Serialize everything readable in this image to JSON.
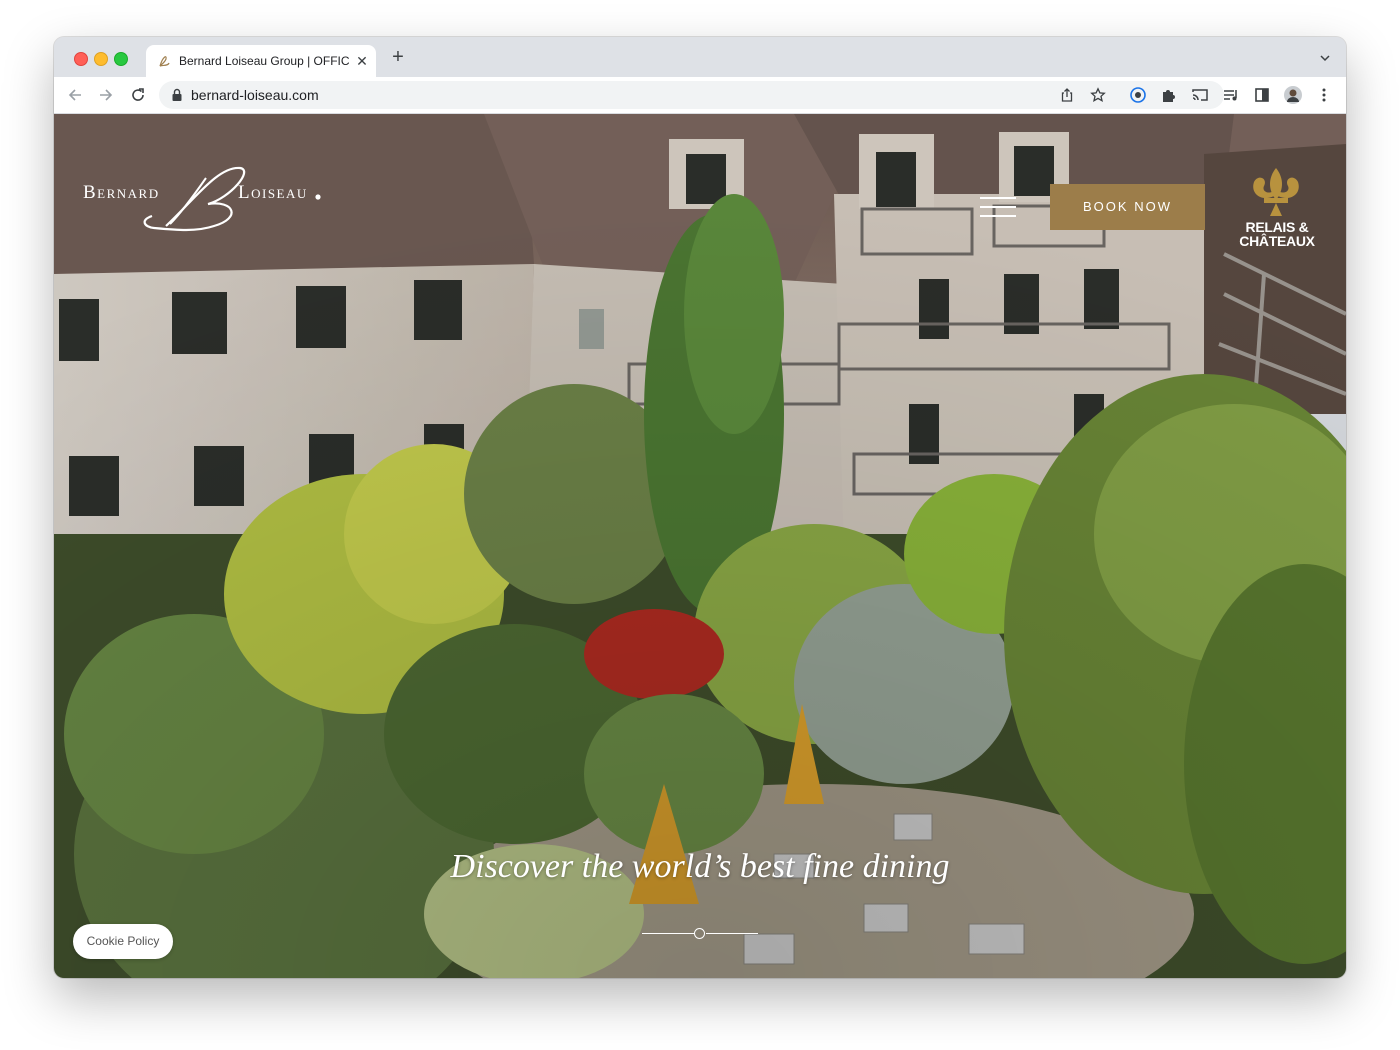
{
  "browser": {
    "tab_title": "Bernard Loiseau Group | OFFIC",
    "url": "bernard-loiseau.com",
    "icons": [
      "back-icon",
      "forward-icon",
      "reload-icon",
      "lock-icon",
      "share-icon",
      "bookmark-star-icon",
      "extension-icon",
      "puzzle-icon",
      "cast-icon",
      "media-icon",
      "sidebar-icon",
      "avatar",
      "menu-dots-icon"
    ]
  },
  "site": {
    "logo_left": "Bernard",
    "logo_right": "Loiseau",
    "book_now": "BOOK NOW",
    "partner_line1": "RELAIS &",
    "partner_line2": "CHÂTEAUX",
    "tagline": "Discover the world’s best fine dining",
    "cookie": "Cookie Policy"
  },
  "colors": {
    "gold": "#9c7d4a",
    "partner_gold": "#b8923e"
  }
}
